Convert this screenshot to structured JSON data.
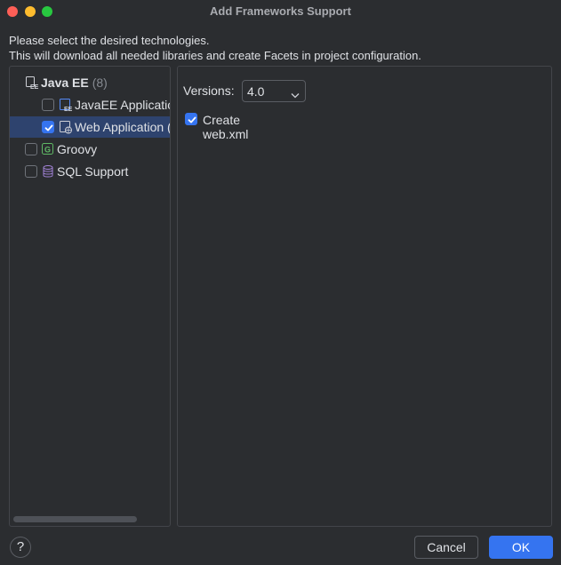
{
  "window": {
    "title": "Add Frameworks Support"
  },
  "description": {
    "line1": "Please select the desired technologies.",
    "line2": "This will download all needed libraries and create Facets in project configuration."
  },
  "tree": {
    "java_ee": {
      "label": "Java EE",
      "count": "(8)",
      "icon": "java-ee-icon"
    },
    "javaee_application": {
      "label": "JavaEE Applicatio",
      "checked": false,
      "icon": "javaee-application-icon"
    },
    "web_application": {
      "label": "Web Application (",
      "checked": true,
      "selected": true,
      "icon": "web-application-icon"
    },
    "groovy": {
      "label": "Groovy",
      "checked": false,
      "icon": "groovy-icon"
    },
    "sql_support": {
      "label": "SQL Support",
      "checked": false,
      "icon": "database-icon"
    }
  },
  "settings": {
    "versions_label": "Versions:",
    "versions_value": "4.0",
    "create_web_xml_label": "Create web.xml",
    "create_web_xml_checked": true
  },
  "footer": {
    "help_label": "?",
    "cancel_label": "Cancel",
    "ok_label": "OK"
  },
  "colors": {
    "background": "#2b2d30",
    "accent": "#3574f0",
    "selection": "#2e436e",
    "groovy": "#5fb865",
    "database": "#a383d8"
  }
}
